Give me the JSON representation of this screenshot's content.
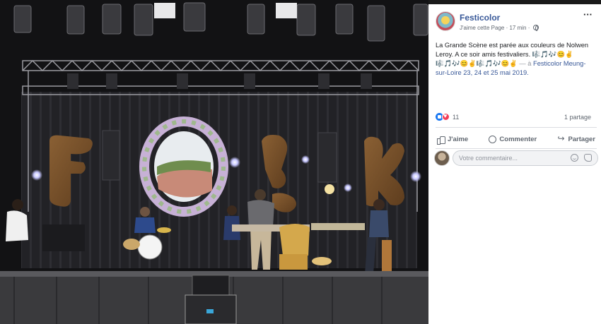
{
  "post": {
    "page_name": "Festicolor",
    "like_page": "J'aime cette Page",
    "separator": "·",
    "time": "17 min",
    "separator2": "·",
    "text": "La Grande Scène est parée aux couleurs de Nolwen Leroy. A ce soir amis festivaliers.",
    "emojis": "🎼🎵🎶😊✌🎼🎵🎶😊✌🎼🎵🎶😊✌",
    "location_prefix": "— à",
    "location_link": "Festicolor Meung-sur-Loire 23, 24 et 25 mai 2019."
  },
  "reactions": {
    "count": "11",
    "shares": "1 partage",
    "like_icon": "like-reaction-icon",
    "love_icon": "love-reaction-icon"
  },
  "actions": {
    "like": "J'aime",
    "comment": "Commenter",
    "share": "Partager"
  },
  "comment_box": {
    "placeholder": "Votre commentaire..."
  },
  "colors": {
    "link": "#385898",
    "meta": "#606770",
    "like_blue": "#1877f2",
    "love_red": "#f33e58",
    "photo_bg": "#141416"
  }
}
